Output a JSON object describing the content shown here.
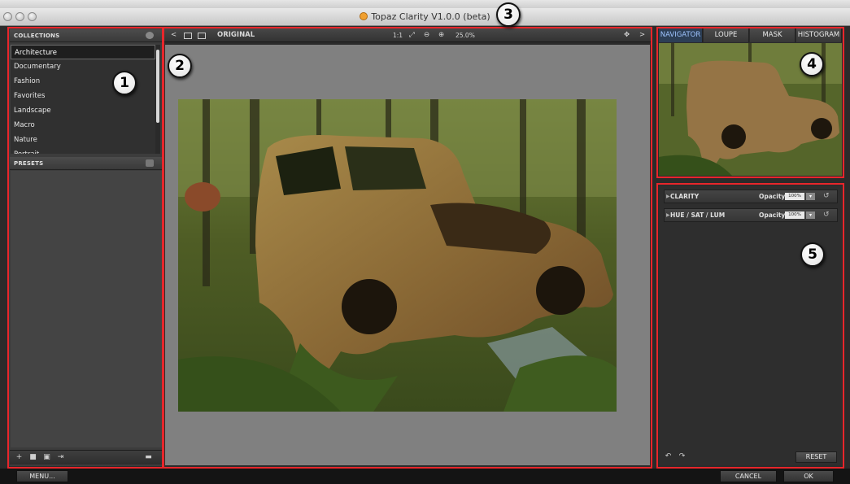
{
  "window": {
    "title": "Topaz Clarity V1.0.0 (beta)"
  },
  "left_panel": {
    "collections_title": "COLLECTIONS",
    "collections": [
      "Architecture",
      "Documentary",
      "Fashion",
      "Favorites",
      "Landscape",
      "Macro",
      "Nature",
      "Portrait"
    ],
    "selected_collection": "Architecture",
    "presets_title": "PRESETS"
  },
  "view_toolbar": {
    "view_mode": "ORIGINAL",
    "zoom_1to1": "1:1",
    "zoom_level": "25.0%"
  },
  "right_panel": {
    "tabs": [
      "NAVIGATOR",
      "LOUPE",
      "MASK",
      "HISTOGRAM"
    ],
    "active_tab": "NAVIGATOR",
    "adjustments": [
      {
        "label": "CLARITY",
        "opacity_label": "Opacity:",
        "opacity_value": "100%"
      },
      {
        "label": "HUE / SAT / LUM",
        "opacity_label": "Opacity:",
        "opacity_value": "100%"
      }
    ],
    "reset_label": "RESET"
  },
  "footer": {
    "menu_label": "MENU...",
    "cancel_label": "CANCEL",
    "ok_label": "OK"
  },
  "callouts": [
    "1",
    "2",
    "3",
    "4",
    "5"
  ],
  "colors": {
    "highlight_border": "#e8262b",
    "panel_bg": "#3c3c3c",
    "canvas_bg": "#808080",
    "active_tab": "#9fc4ff"
  }
}
